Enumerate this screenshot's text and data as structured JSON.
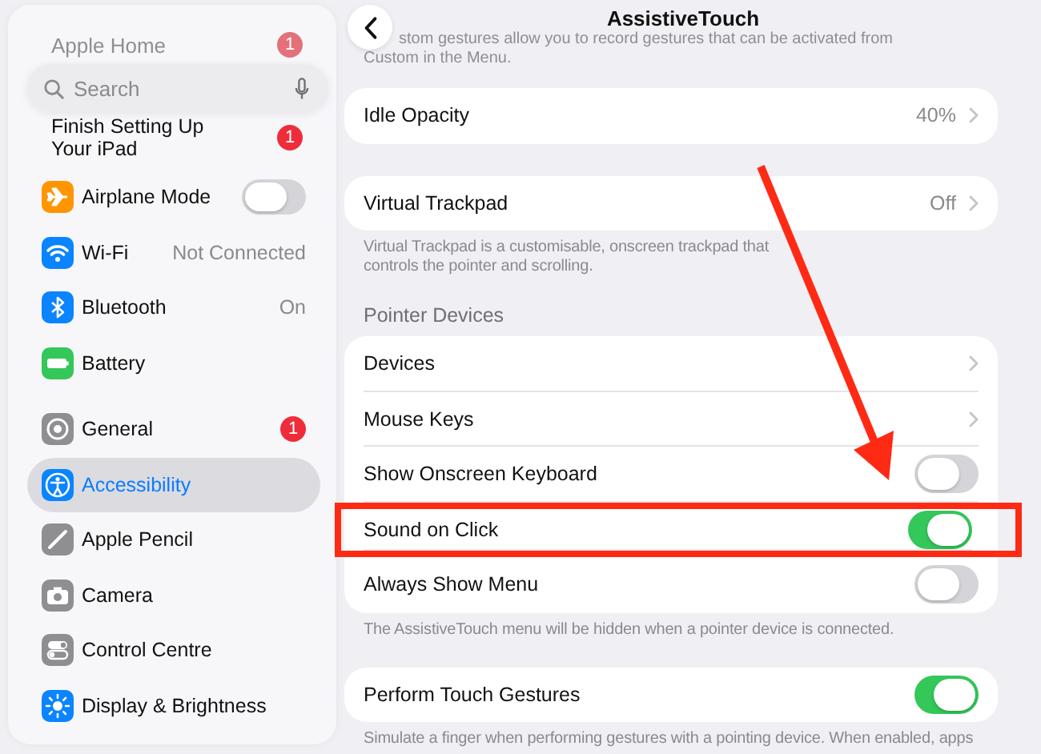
{
  "sidebar": {
    "search": {
      "placeholder": "Search"
    },
    "faded_item": {
      "label": "Apple Home",
      "badge": "1"
    },
    "setup_item": {
      "label": "Finish Setting Up Your iPad",
      "badge": "1"
    },
    "groups": [
      {
        "items": [
          {
            "label": "Airplane Mode",
            "color": "#ff9500",
            "kind": "toggle",
            "on": false,
            "selected": false
          },
          {
            "label": "Wi-Fi",
            "color": "#0a84ff",
            "kind": "value",
            "value": "Not Connected",
            "selected": false
          },
          {
            "label": "Bluetooth",
            "color": "#0a84ff",
            "kind": "value",
            "value": "On",
            "selected": false
          },
          {
            "label": "Battery",
            "color": "#34c759",
            "kind": "plain",
            "selected": false
          }
        ]
      },
      {
        "items": [
          {
            "label": "General",
            "color": "#8e8e93",
            "kind": "badge",
            "badge": "1",
            "selected": false
          },
          {
            "label": "Accessibility",
            "color": "#0a84ff",
            "kind": "plain",
            "selected": true
          },
          {
            "label": "Apple Pencil",
            "color": "#8e8e93",
            "kind": "plain",
            "selected": false
          },
          {
            "label": "Camera",
            "color": "#8e8e93",
            "kind": "plain",
            "selected": false
          },
          {
            "label": "Control Centre",
            "color": "#8e8e93",
            "kind": "plain",
            "selected": false
          },
          {
            "label": "Display & Brightness",
            "color": "#0a84ff",
            "kind": "plain",
            "selected": false
          }
        ]
      }
    ]
  },
  "nav": {
    "title": "AssistiveTouch"
  },
  "intro_text": "stom gestures allow you to record gestures that can be activated from Custom in the Menu.",
  "sections": [
    {
      "rows": [
        {
          "label": "Idle Opacity",
          "kind": "link",
          "value": "40%",
          "highlighted": false
        }
      ]
    },
    {
      "rows": [
        {
          "label": "Virtual Trackpad",
          "kind": "link",
          "value": "Off",
          "highlighted": false
        }
      ],
      "footer": "Virtual Trackpad is a customisable, onscreen trackpad that controls the pointer and scrolling."
    },
    {
      "header": "Pointer Devices",
      "rows": [
        {
          "label": "Devices",
          "kind": "link",
          "highlighted": false
        },
        {
          "label": "Mouse Keys",
          "kind": "link",
          "highlighted": false
        },
        {
          "label": "Show Onscreen Keyboard",
          "kind": "toggle",
          "on": false,
          "highlighted": false
        },
        {
          "label": "Sound on Click",
          "kind": "toggle",
          "on": true,
          "highlighted": true
        },
        {
          "label": "Always Show Menu",
          "kind": "toggle",
          "on": false,
          "highlighted": false
        }
      ],
      "footer": "The AssistiveTouch menu will be hidden when a pointer device is connected."
    },
    {
      "rows": [
        {
          "label": "Perform Touch Gestures",
          "kind": "toggle",
          "on": true,
          "highlighted": false
        }
      ],
      "footer": "Simulate a finger when performing gestures with a pointing device. When enabled, apps"
    }
  ],
  "annotations": {
    "arrow": true
  }
}
